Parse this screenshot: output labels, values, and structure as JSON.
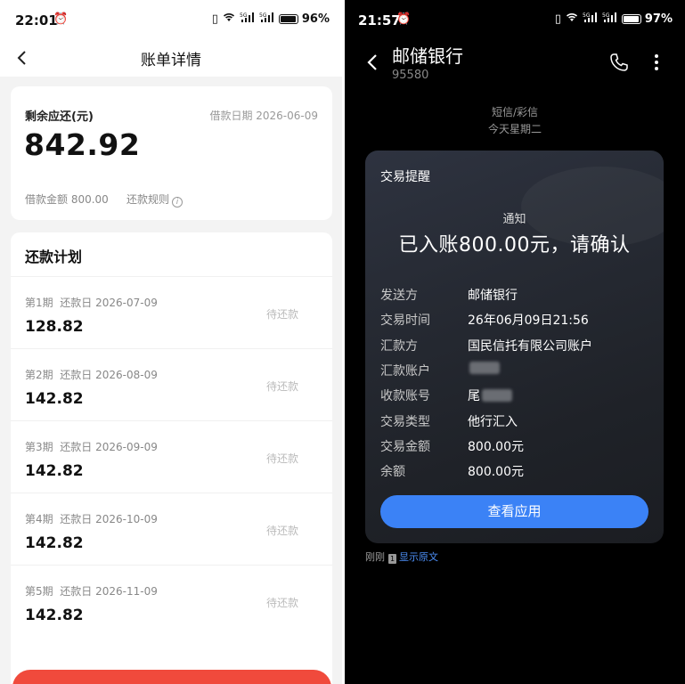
{
  "left": {
    "status": {
      "time": "22:01",
      "battery_pct": "96%",
      "battery_level": 0.96
    },
    "nav": {
      "title": "账单详情"
    },
    "summary": {
      "remaining_label": "剩余应还(元)",
      "loan_date": "借款日期 2026-06-09",
      "amount": "842.92",
      "loan_amount": "借款金额 800.00",
      "rules": "还款规则"
    },
    "plan": {
      "title": "还款计划",
      "rows": [
        {
          "period": "第1期",
          "date": "还款日 2026-07-09",
          "amount": "128.82",
          "status": "待还款"
        },
        {
          "period": "第2期",
          "date": "还款日 2026-08-09",
          "amount": "142.82",
          "status": "待还款"
        },
        {
          "period": "第3期",
          "date": "还款日 2026-09-09",
          "amount": "142.82",
          "status": "待还款"
        },
        {
          "period": "第4期",
          "date": "还款日 2026-10-09",
          "amount": "142.82",
          "status": "待还款"
        },
        {
          "period": "第5期",
          "date": "还款日 2026-11-09",
          "amount": "142.82",
          "status": "待还款"
        }
      ]
    },
    "colors": {
      "accent": "#f04a3c"
    }
  },
  "right": {
    "status": {
      "time": "21:57",
      "battery_pct": "97%",
      "battery_level": 0.97
    },
    "header": {
      "name": "邮储银行",
      "number": "95580"
    },
    "meta": {
      "channel": "短信/彩信",
      "day": "今天星期二"
    },
    "message": {
      "type": "交易提醒",
      "sub": "通知",
      "headline": "已入账800.00元，请确认",
      "fields": [
        {
          "k": "发送方",
          "v": "邮储银行"
        },
        {
          "k": "交易时间",
          "v": "26年06月09日21:56"
        },
        {
          "k": "汇款方",
          "v": "国民信托有限公司账户"
        },
        {
          "k": "汇款账户",
          "v": ""
        },
        {
          "k": "收款账号",
          "v": "尾"
        },
        {
          "k": "交易类型",
          "v": "他行汇入"
        },
        {
          "k": "交易金额",
          "v": "800.00元"
        },
        {
          "k": "余额",
          "v": "800.00元"
        }
      ],
      "button": "查看应用"
    },
    "footer": {
      "when": "刚刚",
      "sim": "1",
      "link": "显示原文"
    },
    "colors": {
      "button": "#3b82f6",
      "link": "#4d8ff7"
    }
  }
}
